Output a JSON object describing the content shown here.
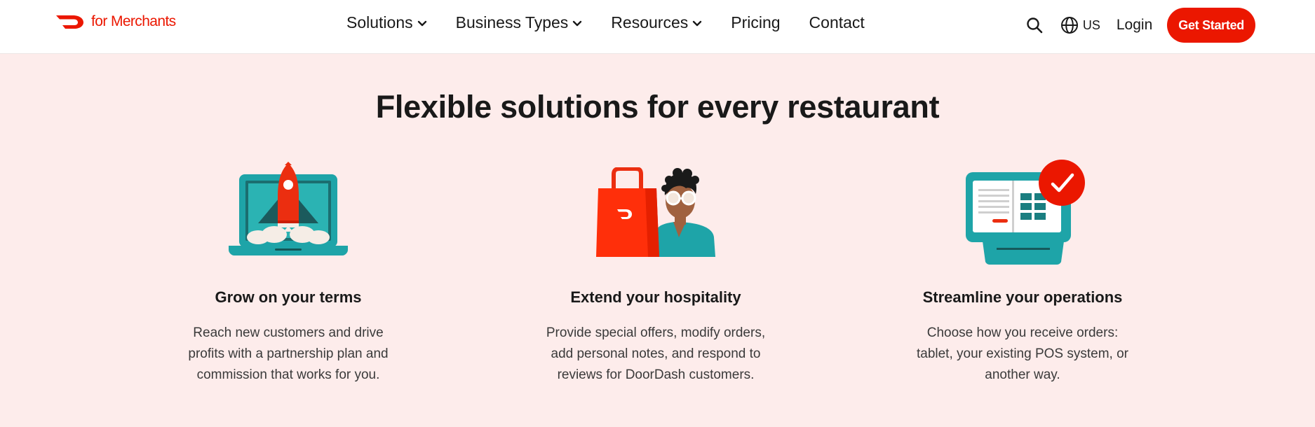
{
  "header": {
    "logo_text": "for Merchants",
    "nav": [
      {
        "label": "Solutions",
        "has_dropdown": true
      },
      {
        "label": "Business Types",
        "has_dropdown": true
      },
      {
        "label": "Resources",
        "has_dropdown": true
      },
      {
        "label": "Pricing",
        "has_dropdown": false
      },
      {
        "label": "Contact",
        "has_dropdown": false
      }
    ],
    "search_icon": "search-icon",
    "locale_icon": "globe-icon",
    "locale_label": "US",
    "login_label": "Login",
    "cta_label": "Get Started"
  },
  "main": {
    "title": "Flexible solutions for every restaurant",
    "features": [
      {
        "illustration": "rocket-laptop-illustration",
        "title": "Grow on your terms",
        "description": "Reach new customers and drive profits with a partnership plan and commission that works for you."
      },
      {
        "illustration": "delivery-bag-person-illustration",
        "title": "Extend your hospitality",
        "description": "Provide special offers, modify orders, add personal notes, and respond to reviews for DoorDash customers."
      },
      {
        "illustration": "tablet-checkmark-illustration",
        "title": "Streamline your operations",
        "description": "Choose how you receive orders: tablet, your existing POS system, or another way."
      }
    ]
  },
  "colors": {
    "brand_red": "#eb1700",
    "section_background": "#fdeceb",
    "teal": "#1ea4a8",
    "text": "#191919"
  }
}
